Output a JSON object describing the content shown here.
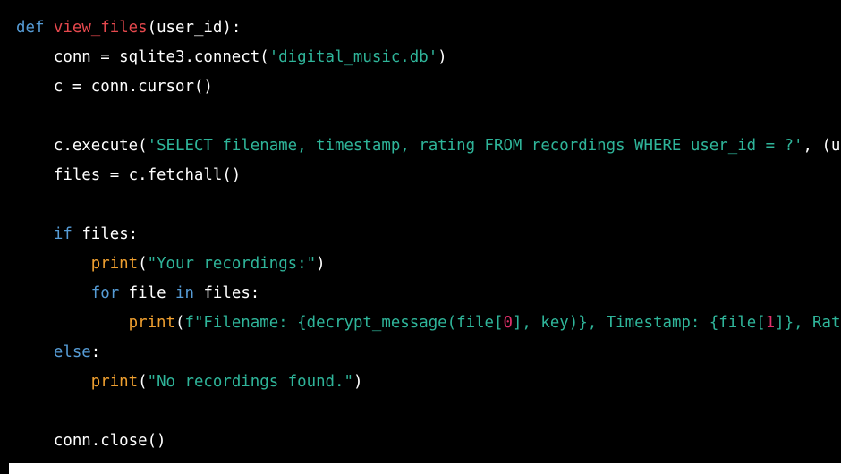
{
  "code": {
    "lines": [
      {
        "tokens": [
          {
            "t": "def",
            "c": "kw"
          },
          {
            "t": " ",
            "c": "plain"
          },
          {
            "t": "view_files",
            "c": "fn"
          },
          {
            "t": "(user_id):",
            "c": "plain"
          }
        ]
      },
      {
        "tokens": [
          {
            "t": "    conn = sqlite3.connect(",
            "c": "plain"
          },
          {
            "t": "'digital_music.db'",
            "c": "str"
          },
          {
            "t": ")",
            "c": "plain"
          }
        ]
      },
      {
        "tokens": [
          {
            "t": "    c = conn.cursor()",
            "c": "plain"
          }
        ]
      },
      {
        "tokens": []
      },
      {
        "tokens": [
          {
            "t": "    c.execute(",
            "c": "plain"
          },
          {
            "t": "'SELECT filename, timestamp, rating FROM recordings WHERE user_id = ?'",
            "c": "str"
          },
          {
            "t": ", (u",
            "c": "plain"
          }
        ]
      },
      {
        "tokens": [
          {
            "t": "    files = c.fetchall()",
            "c": "plain"
          }
        ]
      },
      {
        "tokens": []
      },
      {
        "tokens": [
          {
            "t": "    ",
            "c": "plain"
          },
          {
            "t": "if",
            "c": "kw"
          },
          {
            "t": " files:",
            "c": "plain"
          }
        ]
      },
      {
        "tokens": [
          {
            "t": "        ",
            "c": "plain"
          },
          {
            "t": "print",
            "c": "bi"
          },
          {
            "t": "(",
            "c": "plain"
          },
          {
            "t": "\"Your recordings:\"",
            "c": "str"
          },
          {
            "t": ")",
            "c": "plain"
          }
        ]
      },
      {
        "tokens": [
          {
            "t": "        ",
            "c": "plain"
          },
          {
            "t": "for",
            "c": "kw"
          },
          {
            "t": " file ",
            "c": "plain"
          },
          {
            "t": "in",
            "c": "kw"
          },
          {
            "t": " files:",
            "c": "plain"
          }
        ]
      },
      {
        "tokens": [
          {
            "t": "            ",
            "c": "plain"
          },
          {
            "t": "print",
            "c": "bi"
          },
          {
            "t": "(",
            "c": "plain"
          },
          {
            "t": "f\"Filename: {decrypt_message(file[",
            "c": "str"
          },
          {
            "t": "0",
            "c": "num"
          },
          {
            "t": "], key)}, Timestamp: {file[",
            "c": "str"
          },
          {
            "t": "1",
            "c": "num"
          },
          {
            "t": "]}, Rat",
            "c": "str"
          }
        ]
      },
      {
        "tokens": [
          {
            "t": "    ",
            "c": "plain"
          },
          {
            "t": "else",
            "c": "kw"
          },
          {
            "t": ":",
            "c": "plain"
          }
        ]
      },
      {
        "tokens": [
          {
            "t": "        ",
            "c": "plain"
          },
          {
            "t": "print",
            "c": "bi"
          },
          {
            "t": "(",
            "c": "plain"
          },
          {
            "t": "\"No recordings found.\"",
            "c": "str"
          },
          {
            "t": ")",
            "c": "plain"
          }
        ]
      },
      {
        "tokens": []
      },
      {
        "tokens": [
          {
            "t": "    conn.close()",
            "c": "plain"
          }
        ]
      }
    ]
  },
  "colors": {
    "background": "#000000",
    "keyword": "#569cd6",
    "function_name": "#e5484d",
    "builtin": "#f0a030",
    "string": "#2fb59a",
    "number": "#e0306a",
    "text": "#ffffff"
  }
}
